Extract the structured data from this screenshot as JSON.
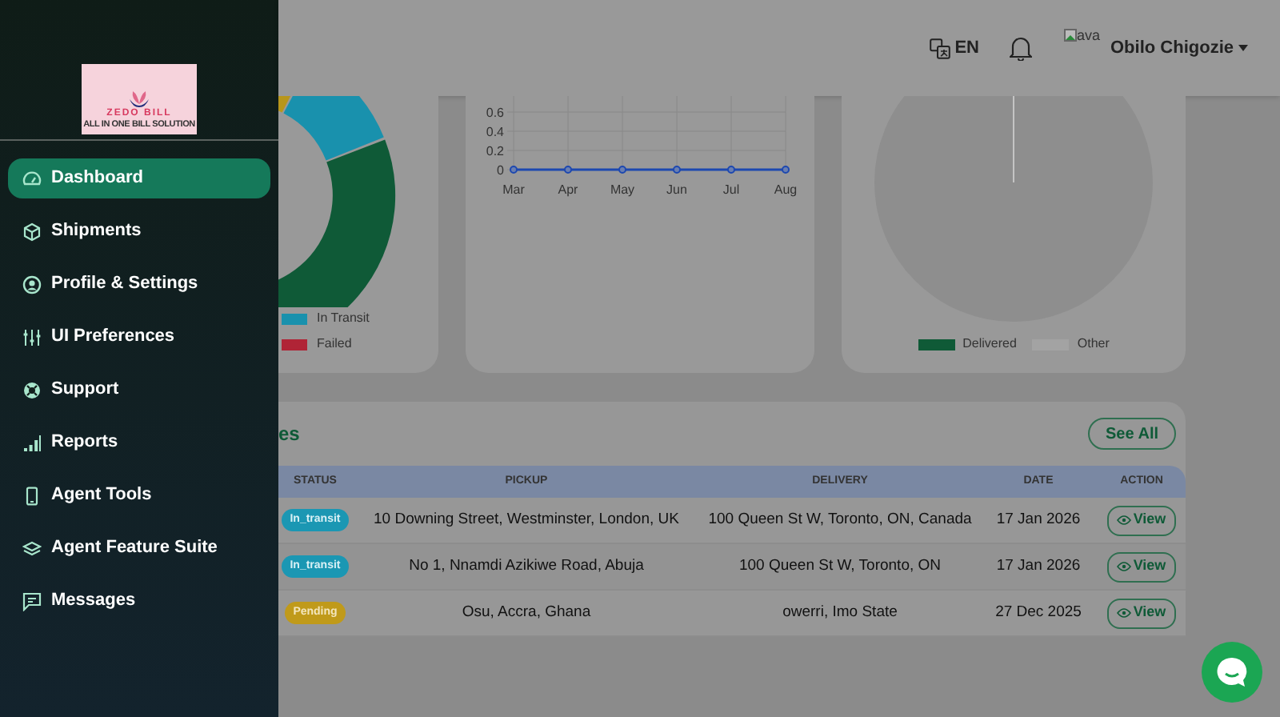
{
  "sidebar": {
    "logo": {
      "title": "ZEDO BILL",
      "tagline": "ALL IN ONE BILL SOLUTION"
    },
    "items": [
      {
        "label": "Dashboard",
        "selected": true
      },
      {
        "label": "Shipments",
        "selected": false
      },
      {
        "label": "Profile & Settings",
        "selected": false
      },
      {
        "label": "UI Preferences",
        "selected": false
      },
      {
        "label": "Support",
        "selected": false
      },
      {
        "label": "Reports",
        "selected": false
      },
      {
        "label": "Agent Tools",
        "selected": false
      },
      {
        "label": "Agent Feature Suite",
        "selected": false
      },
      {
        "label": "Messages",
        "selected": false
      }
    ]
  },
  "header": {
    "language": "EN",
    "avatar_alt": "ava",
    "user_name": "Obilo Chigozie"
  },
  "status_chart": {
    "legend": [
      {
        "label": "In Transit",
        "color": "#1991ad"
      },
      {
        "label": "Failed",
        "color": "#b02436"
      }
    ]
  },
  "trend_chart": {
    "chart_data": {
      "type": "line",
      "categories": [
        "Mar",
        "Apr",
        "May",
        "Jun",
        "Jul",
        "Aug"
      ],
      "yticks": [
        0,
        0.2,
        0.4,
        0.6
      ],
      "ylim": [
        0,
        0.6
      ],
      "grid": true,
      "series": [
        {
          "color": "#1d48b0",
          "marker": true,
          "values": [
            0,
            0,
            0,
            0,
            0,
            0
          ]
        }
      ]
    }
  },
  "delivery_chart": {
    "legend": [
      {
        "label": "Delivered",
        "color": "#0f5a37"
      },
      {
        "label": "Other",
        "color": "#a3a3a3"
      }
    ]
  },
  "shipments": {
    "title": "es",
    "see_all": "See All",
    "columns": [
      "STATUS",
      "PICKUP",
      "DELIVERY",
      "DATE",
      "ACTION"
    ],
    "rows": [
      {
        "status": "In_transit",
        "kind": "in_transit",
        "pickup": "10 Downing Street, Westminster, London, UK",
        "delivery": "100 Queen St W, Toronto, ON, Canada",
        "date": "17 Jan 2026",
        "action": "View"
      },
      {
        "status": "In_transit",
        "kind": "in_transit",
        "pickup": "No 1, Nnamdi Azikiwe Road, Abuja",
        "delivery": "100 Queen St W, Toronto, ON",
        "date": "17 Jan 2026",
        "action": "View"
      },
      {
        "status": "Pending",
        "kind": "pending",
        "pickup": "Osu, Accra, Ghana",
        "delivery": "owerri, Imo State",
        "date": "27 Dec 2025",
        "action": "View"
      }
    ]
  }
}
